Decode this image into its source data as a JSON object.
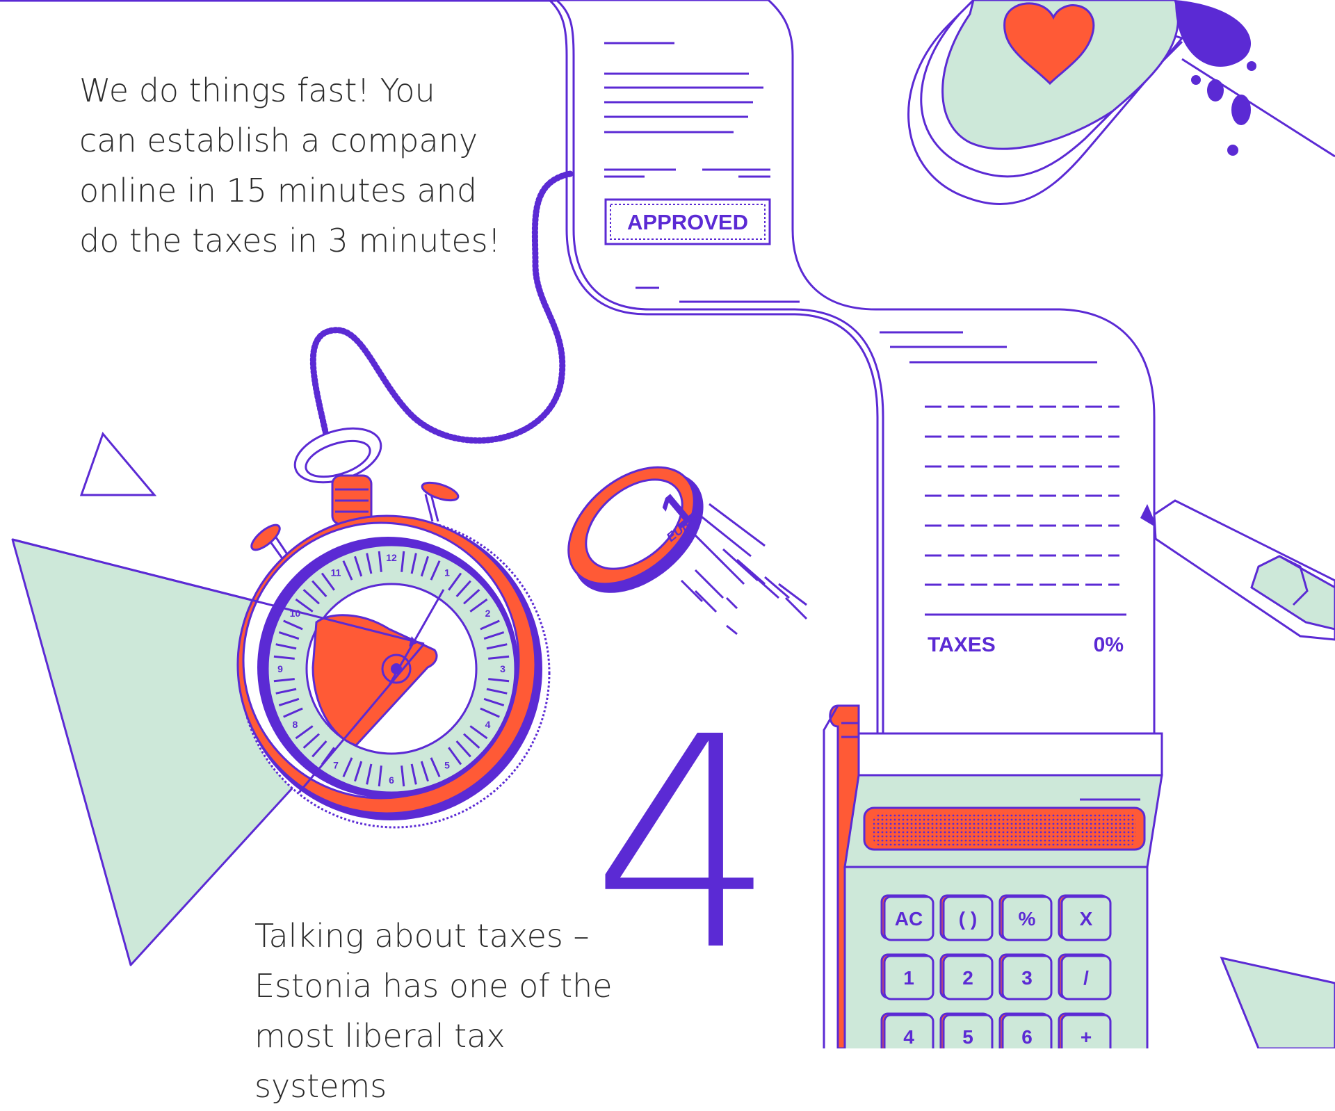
{
  "intro": {
    "lines": [
      "We do things fast! You",
      "can establish a company",
      "online in 15 minutes and",
      "do the taxes in 3 minutes!"
    ]
  },
  "taxes_text": {
    "lines": [
      "Talking about taxes –",
      "Estonia has one of the",
      "most liberal tax systems"
    ]
  },
  "big_number": "4",
  "receipt": {
    "stamp": "APPROVED",
    "taxes_label": "TAXES",
    "taxes_value": "0%"
  },
  "coin": {
    "label": "EURO",
    "value": "1"
  },
  "stopwatch": {
    "numbers": [
      "12",
      "1",
      "2",
      "3",
      "4",
      "5",
      "6",
      "7",
      "8",
      "9",
      "10",
      "11"
    ]
  },
  "calculator": {
    "keys": [
      [
        "AC",
        "( )",
        "%",
        "X"
      ],
      [
        "1",
        "2",
        "3",
        "/"
      ],
      [
        "4",
        "5",
        "6",
        "+"
      ]
    ]
  },
  "colors": {
    "purple": "#5b2ad4",
    "orange": "#ff5a36",
    "mint": "#cde8d9",
    "text": "#2b2b2b"
  }
}
